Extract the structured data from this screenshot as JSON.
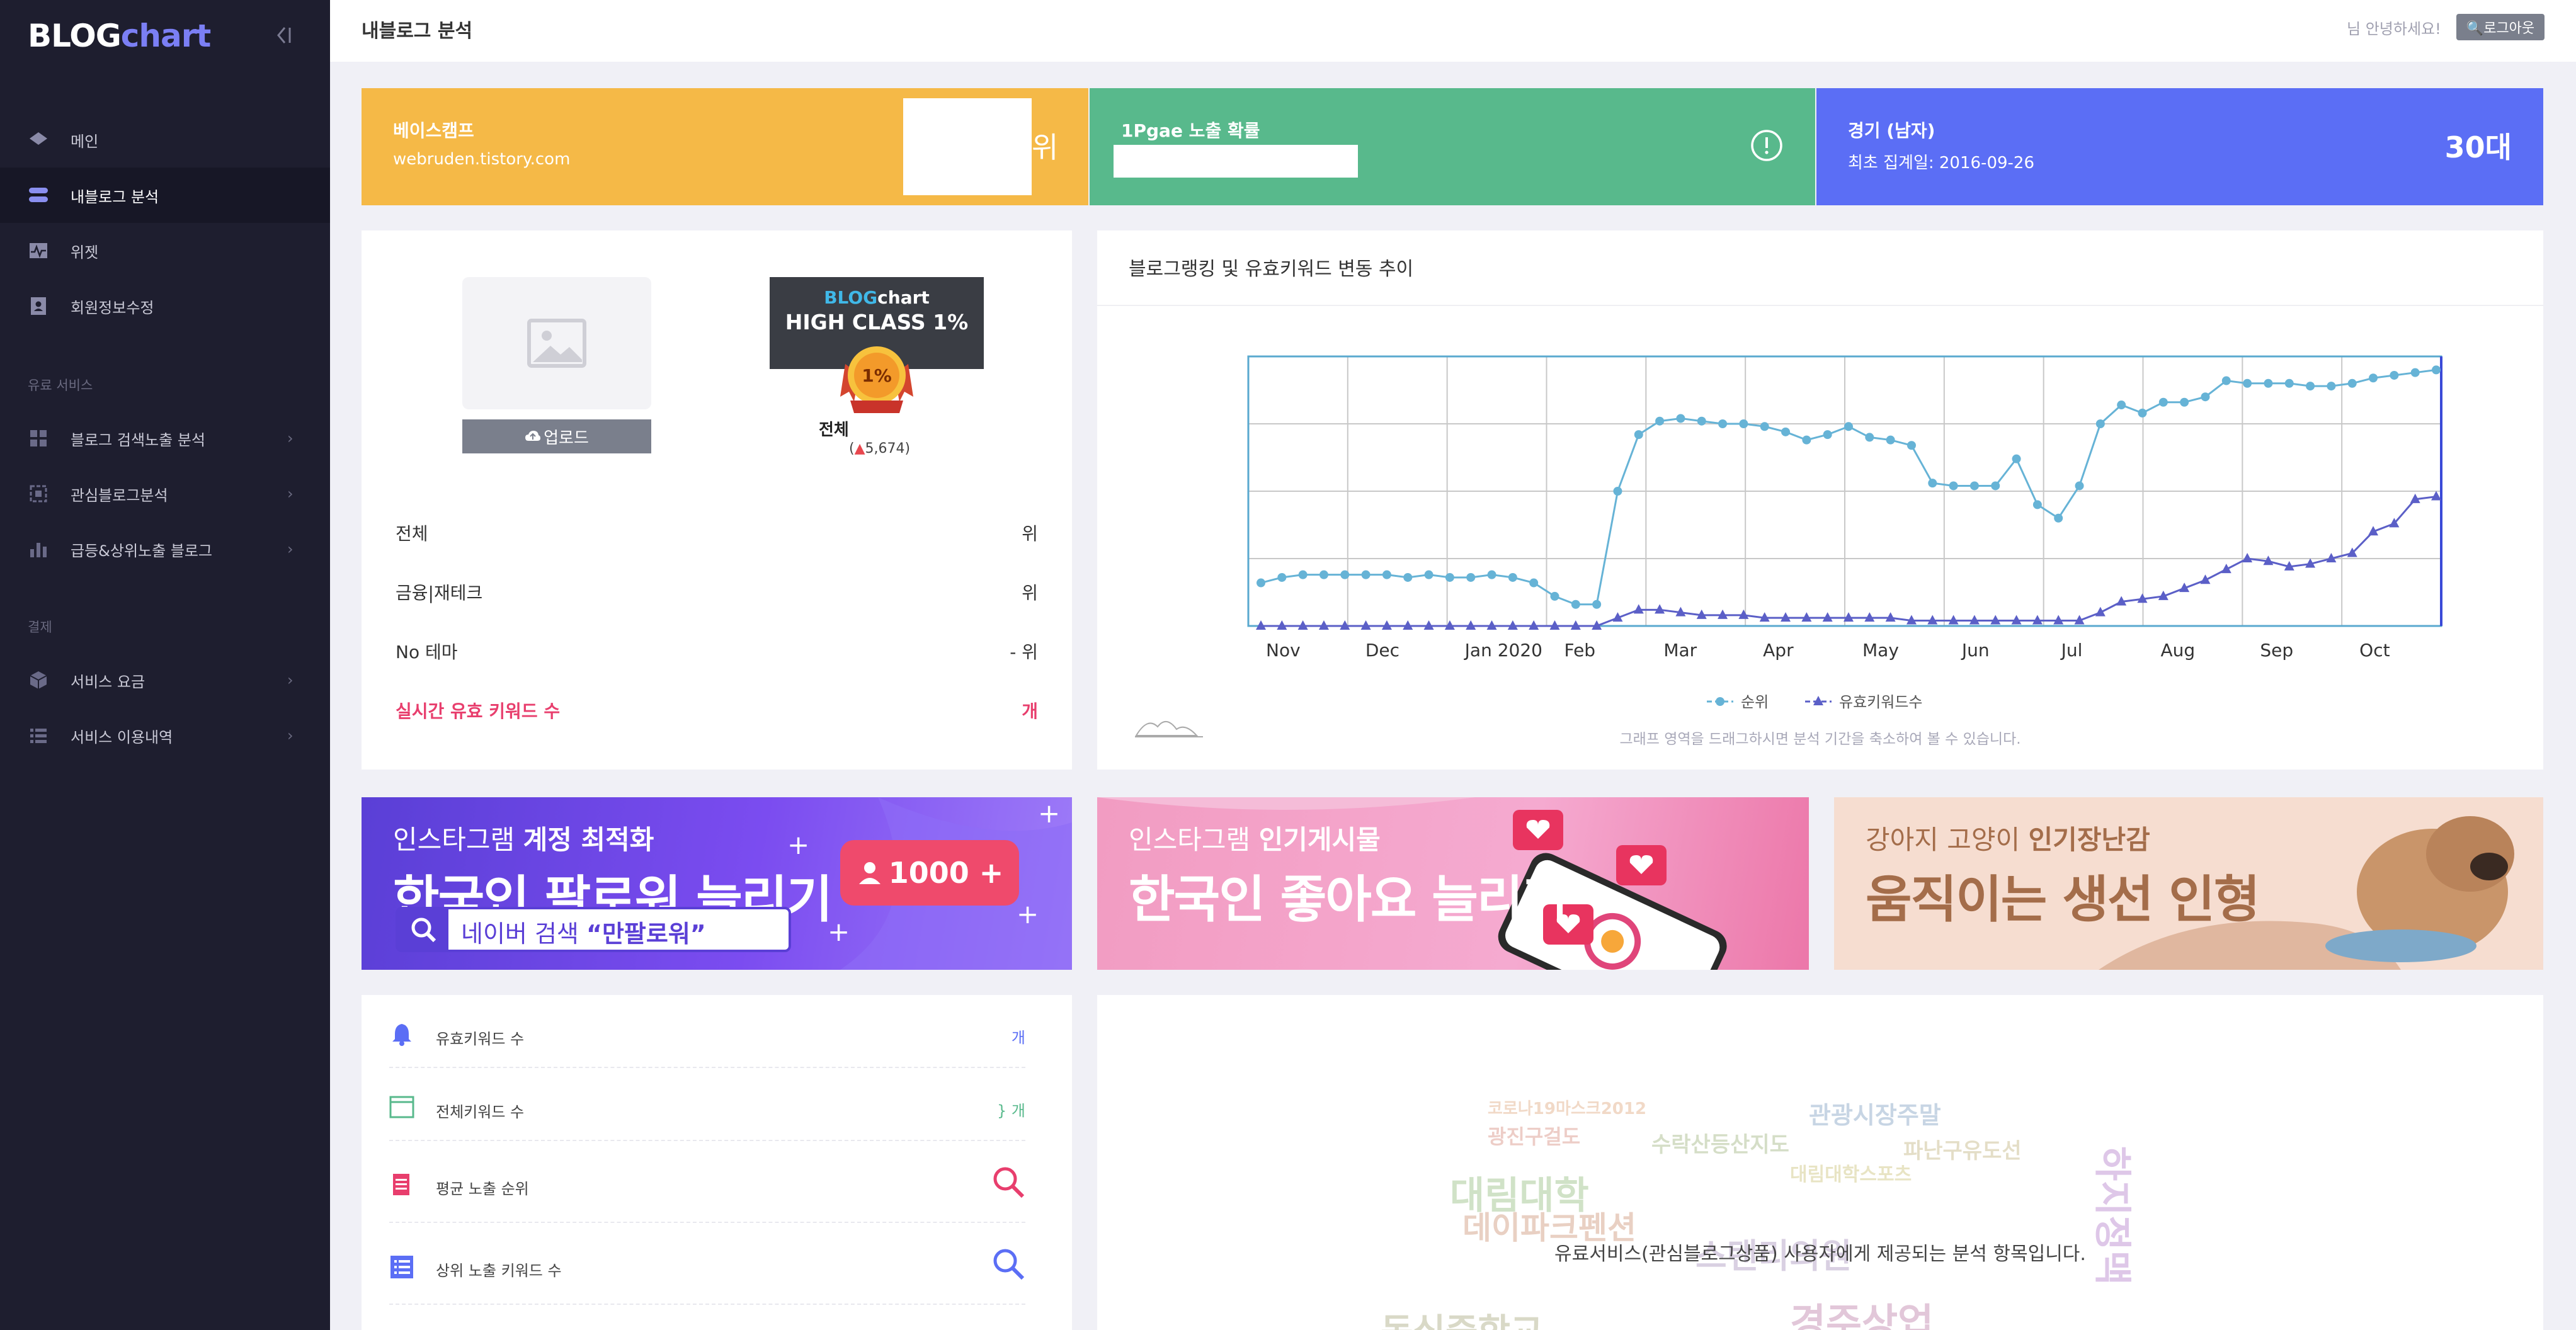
{
  "app": {
    "logo_blog": "BLOG",
    "logo_chart": "chart"
  },
  "sidebar": {
    "items": [
      {
        "label": "메인"
      },
      {
        "label": "내블로그 분석"
      },
      {
        "label": "위젯"
      },
      {
        "label": "회원정보수정"
      }
    ],
    "section_paid": "유료 서비스",
    "paid_items": [
      {
        "label": "블로그 검색노출 분석"
      },
      {
        "label": "관심블로그분석"
      },
      {
        "label": "급등&상위노출 블로그"
      }
    ],
    "section_payment": "결제",
    "payment_items": [
      {
        "label": "서비스 요금"
      },
      {
        "label": "서비스 이용내역"
      }
    ],
    "chevron": "›"
  },
  "header": {
    "title": "내블로그 분석",
    "greeting": "님 안녕하세요!",
    "logout": "🔍로그아웃"
  },
  "stats": {
    "blog_name": "베이스캠프",
    "blog_url": "webruden.tistory.com",
    "rank_suffix": "위",
    "exposure_title": "1Pgae 노출 확률",
    "category_title": "경기 (남자)",
    "first_collected": "최초 집계일: 2016-09-26",
    "age": "30대"
  },
  "profile": {
    "upload_label": "업로드",
    "badge_logo_a": "BLOG",
    "badge_logo_b": "chart",
    "badge_text": "HIGH CLASS 1%",
    "medal_text": "1%",
    "overall_label": "전체",
    "overall_count_open": "(",
    "overall_count_arrow": "▲",
    "overall_count": "5,674)",
    "rows": [
      {
        "label": "전체",
        "value": "위"
      },
      {
        "label": "금융|재테크",
        "value": "위"
      },
      {
        "label": "No 테마",
        "value": "- 위"
      },
      {
        "label": "실시간 유효 키워드 수",
        "value": "개"
      }
    ]
  },
  "chart": {
    "title": "블로그랭킹 및 유효키워드 변동 추이",
    "hint": "그래프 영역을 드래그하시면 분석 기간을 축소하여 볼 수 있습니다."
  },
  "chart_data": {
    "type": "line",
    "x_labels": [
      "Nov",
      "Dec",
      "Jan 2020",
      "Feb",
      "Mar",
      "Apr",
      "May",
      "Jun",
      "Jul",
      "Aug",
      "Sep",
      "Oct"
    ],
    "series": [
      {
        "name": "순위",
        "color": "#66b3d6",
        "values": [
          0.16,
          0.18,
          0.19,
          0.19,
          0.19,
          0.19,
          0.19,
          0.18,
          0.19,
          0.18,
          0.18,
          0.19,
          0.18,
          0.16,
          0.11,
          0.08,
          0.08,
          0.5,
          0.71,
          0.76,
          0.77,
          0.76,
          0.75,
          0.75,
          0.74,
          0.72,
          0.69,
          0.71,
          0.74,
          0.7,
          0.69,
          0.67,
          0.53,
          0.52,
          0.52,
          0.52,
          0.62,
          0.45,
          0.4,
          0.52,
          0.75,
          0.82,
          0.79,
          0.83,
          0.83,
          0.85,
          0.91,
          0.9,
          0.9,
          0.9,
          0.89,
          0.89,
          0.9,
          0.92,
          0.93,
          0.94,
          0.95
        ]
      },
      {
        "name": "유효키워드수",
        "color": "#5b5fc7",
        "values": [
          0.0,
          0.0,
          0.0,
          0.0,
          0.0,
          0.0,
          0.0,
          0.0,
          0.0,
          0.0,
          0.0,
          0.0,
          0.0,
          0.0,
          0.0,
          0.0,
          0.0,
          0.03,
          0.06,
          0.06,
          0.05,
          0.04,
          0.04,
          0.04,
          0.03,
          0.03,
          0.03,
          0.03,
          0.03,
          0.03,
          0.03,
          0.02,
          0.02,
          0.02,
          0.02,
          0.02,
          0.02,
          0.02,
          0.02,
          0.02,
          0.05,
          0.09,
          0.1,
          0.11,
          0.14,
          0.17,
          0.21,
          0.25,
          0.24,
          0.22,
          0.23,
          0.25,
          0.27,
          0.35,
          0.38,
          0.47,
          0.48
        ]
      }
    ],
    "legend_position": "bottom-center",
    "grid": true
  },
  "banners": [
    {
      "small_a": "인스타그램 ",
      "small_b": "계정 최적화",
      "big": "한국인 팔로워 늘리기",
      "pill": "1000 +",
      "search_prefix": "네이버 검색 ",
      "search_bold": "“만팔로워”"
    },
    {
      "small_a": "인스타그램 ",
      "small_b": "인기게시물",
      "big": "한국인 좋아요 늘리기"
    },
    {
      "small_a": "강아지 고양이 ",
      "small_b": "인기장난감",
      "big": "움직이는 생선 인형"
    }
  ],
  "keywords": {
    "rows": [
      {
        "label": "유효키워드 수",
        "value": "개",
        "icon": "bell-icon"
      },
      {
        "label": "전체키워드 수",
        "value": "} 개",
        "icon": "window-icon"
      },
      {
        "label": "평균 노출 순위",
        "icon": "document-icon"
      },
      {
        "label": "상위 노출 키워드 수",
        "icon": "list-icon"
      }
    ]
  },
  "cloud": {
    "note": "유료서비스(관심블로그상품) 사용자에게 제공되는 분석 항목입니다.",
    "words": [
      "대림대학",
      "데이파크펜션",
      "스탠리의원",
      "관광시장주말",
      "파난구유도선",
      "광진구걸도",
      "수락산등산지도",
      "코로나19마스크2012",
      "대림대학스포츠",
      "경주상업",
      "동심중학교",
      "하지정맥"
    ]
  },
  "colors": {
    "sidebar": "#1e1e2f",
    "stat_yellow": "#f5b947",
    "stat_green": "#58b98c",
    "stat_blue": "#5b6ef5",
    "accent_red": "#e83e6d"
  }
}
